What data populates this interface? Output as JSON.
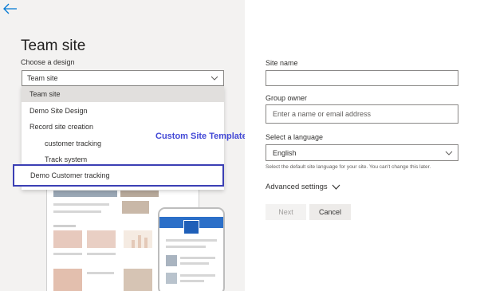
{
  "header": {
    "title": "Team site",
    "design_label": "Choose a design"
  },
  "design_select": {
    "value": "Team site"
  },
  "dropdown": {
    "items": [
      {
        "label": "Team site"
      },
      {
        "label": "Demo Site Design"
      },
      {
        "label": "Record site creation"
      },
      {
        "label": "customer tracking"
      },
      {
        "label": "Track system"
      },
      {
        "label": "Demo Customer tracking"
      }
    ]
  },
  "annotation": "Custom Site Template",
  "form": {
    "site_name_label": "Site name",
    "site_name_value": "",
    "group_owner_label": "Group owner",
    "group_owner_placeholder": "Enter a name or email address",
    "language_label": "Select a language",
    "language_value": "English",
    "language_helper": "Select the default site language for your site. You can't change this later.",
    "advanced_label": "Advanced settings"
  },
  "buttons": {
    "next": "Next",
    "cancel": "Cancel"
  },
  "colors": {
    "highlight": "#3b3fb4",
    "annotation": "#4248d6",
    "phone_accent": "#2b6fc8"
  }
}
